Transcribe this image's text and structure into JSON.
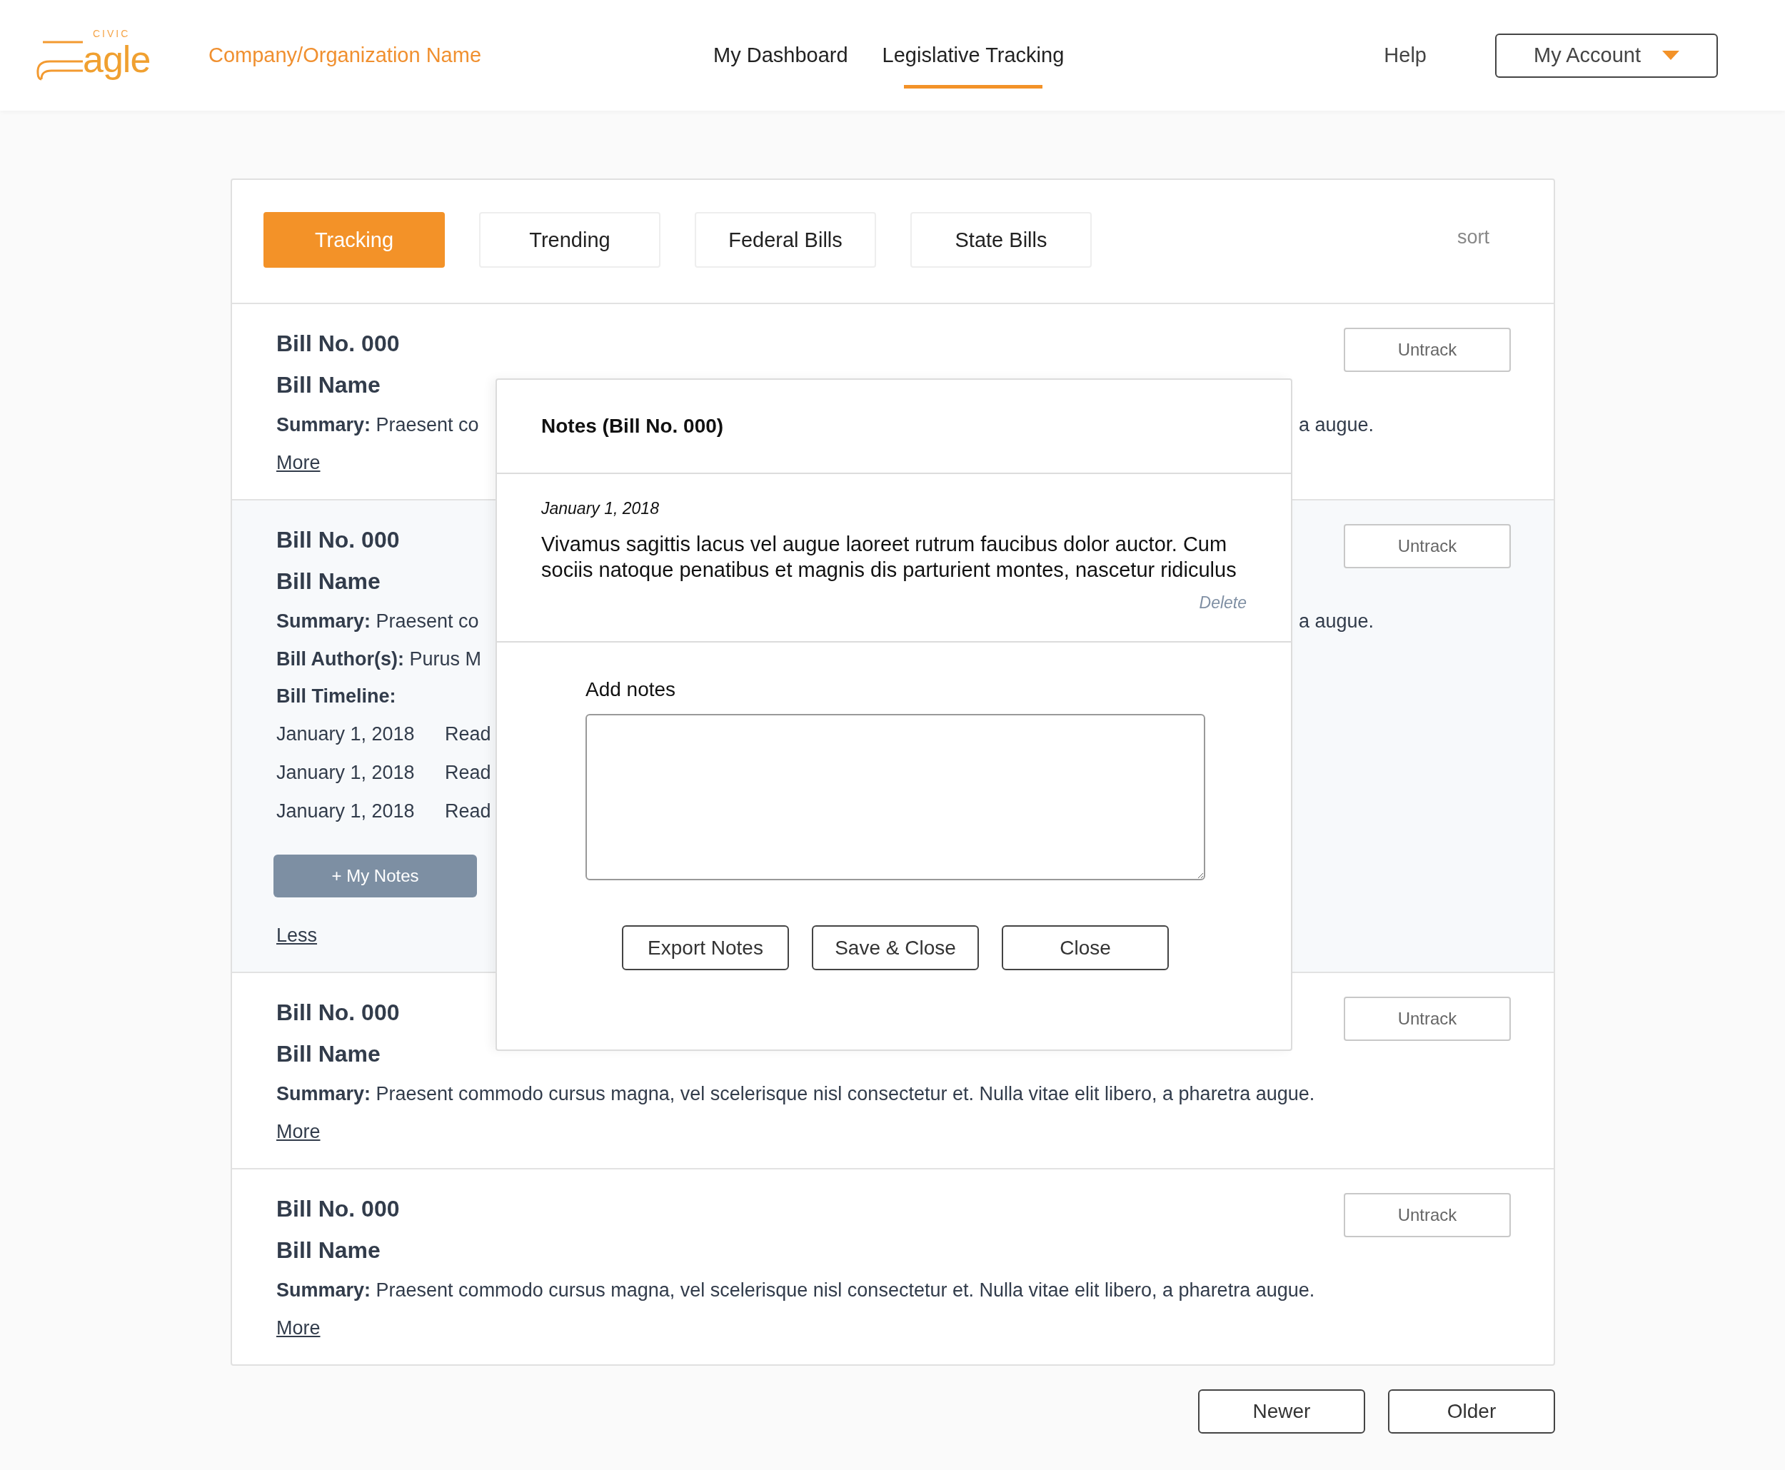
{
  "header": {
    "logo": {
      "small": "CIVIC",
      "word": "agle"
    },
    "organization": "Company/Organization Name",
    "nav": [
      {
        "label": "My Dashboard",
        "selected": false
      },
      {
        "label": "Legislative Tracking",
        "selected": true
      }
    ],
    "help": "Help",
    "account": "My Account"
  },
  "tabs": [
    {
      "label": "Tracking",
      "selected": true
    },
    {
      "label": "Trending",
      "selected": false
    },
    {
      "label": "Federal Bills",
      "selected": false
    },
    {
      "label": "State Bills",
      "selected": false
    }
  ],
  "sort": "sort",
  "bills": [
    {
      "number": "Bill No. 000",
      "name": "Bill Name",
      "summary_label": "Summary:",
      "summary": "Praesent co",
      "summary_end": "a augue.",
      "toggle": "More",
      "expanded": false,
      "action": "Untrack"
    },
    {
      "number": "Bill No. 000",
      "name": "Bill Name",
      "summary_label": "Summary:",
      "summary": "Praesent co",
      "summary_end": "a augue.",
      "authors_label": "Bill Author(s):",
      "authors": "Purus M",
      "timeline_label": "Bill Timeline:",
      "timeline": [
        {
          "date": "January 1, 2018",
          "event": "Read"
        },
        {
          "date": "January 1, 2018",
          "event": "Read"
        },
        {
          "date": "January 1, 2018",
          "event": "Read"
        }
      ],
      "notes_button": "+ My Notes",
      "toggle": "Less",
      "expanded": true,
      "action": "Untrack"
    },
    {
      "number": "Bill No. 000",
      "name": "Bill Name",
      "summary_label": "Summary:",
      "summary": "Praesent commodo cursus magna, vel scelerisque nisl consectetur et. Nulla vitae elit libero, a pharetra augue.",
      "toggle": "More",
      "expanded": false,
      "action": "Untrack"
    },
    {
      "number": "Bill No. 000",
      "name": "Bill Name",
      "summary_label": "Summary:",
      "summary": "Praesent commodo cursus magna, vel scelerisque nisl consectetur et. Nulla vitae elit libero, a pharetra augue.",
      "toggle": "More",
      "expanded": false,
      "action": "Untrack"
    }
  ],
  "notes_modal": {
    "title": "Notes (Bill No. 000)",
    "notes": [
      {
        "date": "January 1, 2018",
        "text": "Vivamus sagittis lacus vel augue laoreet rutrum faucibus dolor auctor. Cum sociis natoque penatibus et magnis dis parturient montes, nascetur ridiculus",
        "delete": "Delete"
      }
    ],
    "add_label": "Add notes",
    "buttons": [
      "Export Notes",
      "Save & Close",
      "Close"
    ]
  },
  "pager": [
    "Newer",
    "Older"
  ]
}
